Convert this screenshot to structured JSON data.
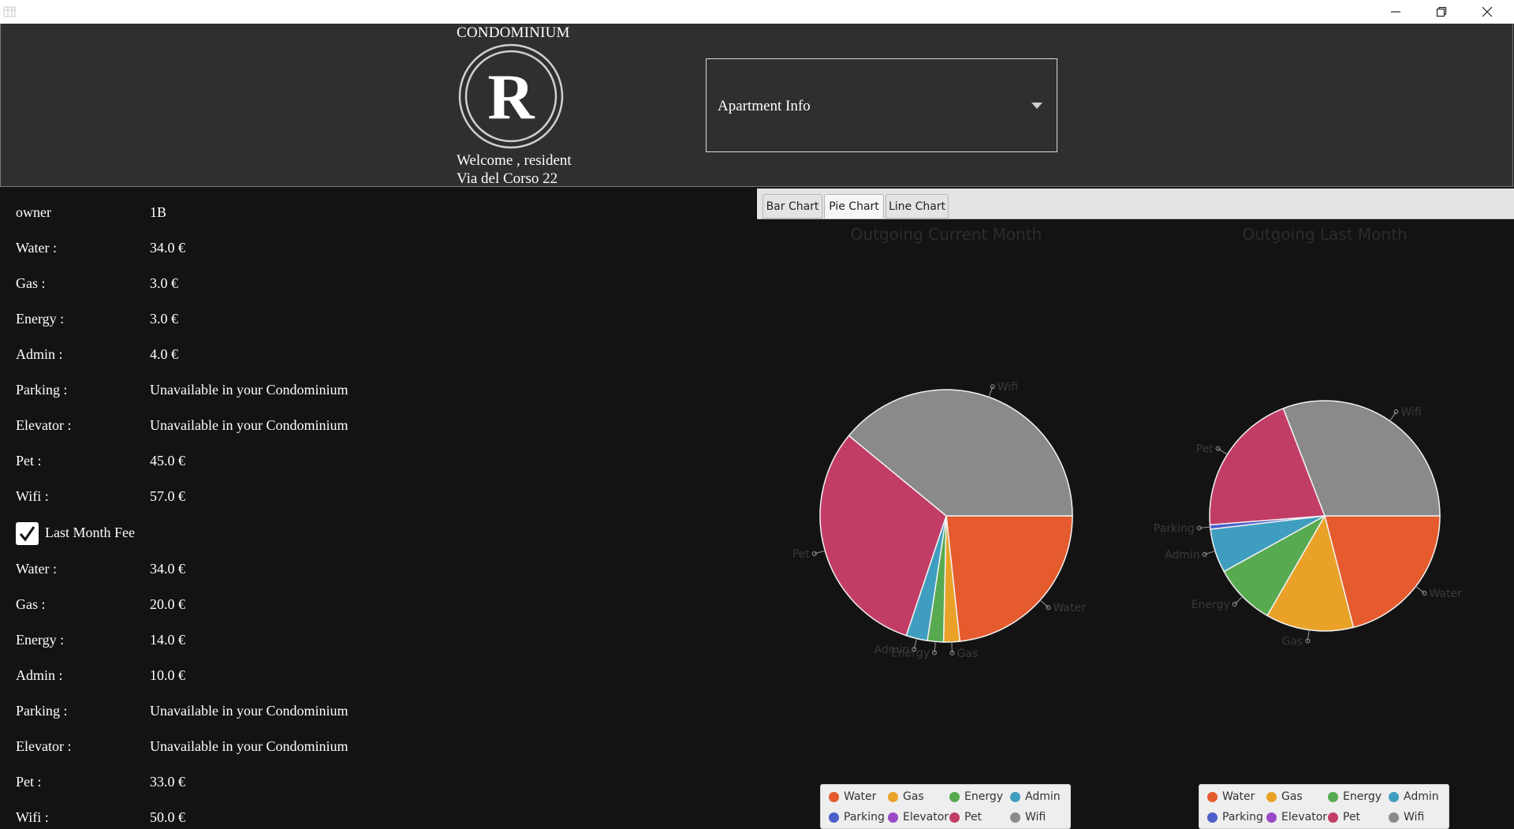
{
  "header": {
    "brand": "CONDOMINIUM",
    "logo_letter": "R",
    "welcome": "Welcome , resident",
    "address": "Via del Corso 22",
    "dropdown_value": "Apartment Info"
  },
  "current_fees": {
    "rows": [
      {
        "label": "owner",
        "value": "1B"
      },
      {
        "label": "Water :",
        "value": "34.0 €"
      },
      {
        "label": "Gas :",
        "value": "3.0 €"
      },
      {
        "label": "Energy :",
        "value": "3.0 €"
      },
      {
        "label": "Admin :",
        "value": "4.0 €"
      },
      {
        "label": "Parking :",
        "value": "Unavailable in your Condominium"
      },
      {
        "label": "Elevator :",
        "value": "Unavailable in your Condominium"
      },
      {
        "label": "Pet :",
        "value": "45.0 €"
      },
      {
        "label": "Wifi :",
        "value": "57.0 €"
      }
    ]
  },
  "last_month": {
    "checkbox_label": "Last Month Fee",
    "checked": true,
    "rows": [
      {
        "label": "Water :",
        "value": "34.0 €"
      },
      {
        "label": "Gas :",
        "value": "20.0 €"
      },
      {
        "label": "Energy :",
        "value": "14.0 €"
      },
      {
        "label": "Admin :",
        "value": "10.0 €"
      },
      {
        "label": "Parking :",
        "value": "Unavailable in your Condominium"
      },
      {
        "label": "Elevator :",
        "value": "Unavailable in your Condominium"
      },
      {
        "label": "Pet :",
        "value": "33.0 €"
      },
      {
        "label": "Wifi :",
        "value": "50.0 €"
      }
    ]
  },
  "tabs": [
    {
      "label": "Bar Chart",
      "selected": false
    },
    {
      "label": "Pie Chart",
      "selected": true
    },
    {
      "label": "Line Chart",
      "selected": false
    }
  ],
  "legend": [
    {
      "name": "Water",
      "color": "#e55b2d"
    },
    {
      "name": "Gas",
      "color": "#e9a227"
    },
    {
      "name": "Energy",
      "color": "#58aa50"
    },
    {
      "name": "Admin",
      "color": "#3f9ebf"
    },
    {
      "name": "Parking",
      "color": "#4a5fc9"
    },
    {
      "name": "Elevator",
      "color": "#9b49c9"
    },
    {
      "name": "Pet",
      "color": "#c23d66"
    },
    {
      "name": "Wifi",
      "color": "#8a8a8a"
    }
  ],
  "chart_data": [
    {
      "type": "pie",
      "title": "Outgoing Current Month",
      "slices": [
        {
          "label": "Water",
          "value": 34
        },
        {
          "label": "Gas",
          "value": 3
        },
        {
          "label": "Energy",
          "value": 3
        },
        {
          "label": "Admin",
          "value": 4
        },
        {
          "label": "Pet",
          "value": 45
        },
        {
          "label": "Wifi",
          "value": 57
        }
      ]
    },
    {
      "type": "pie",
      "title": "Outgoing Last Month",
      "slices": [
        {
          "label": "Water",
          "value": 34
        },
        {
          "label": "Gas",
          "value": 20
        },
        {
          "label": "Energy",
          "value": 14
        },
        {
          "label": "Admin",
          "value": 10
        },
        {
          "label": "Parking",
          "value": 1
        },
        {
          "label": "Pet",
          "value": 33
        },
        {
          "label": "Wifi",
          "value": 50
        }
      ]
    }
  ]
}
